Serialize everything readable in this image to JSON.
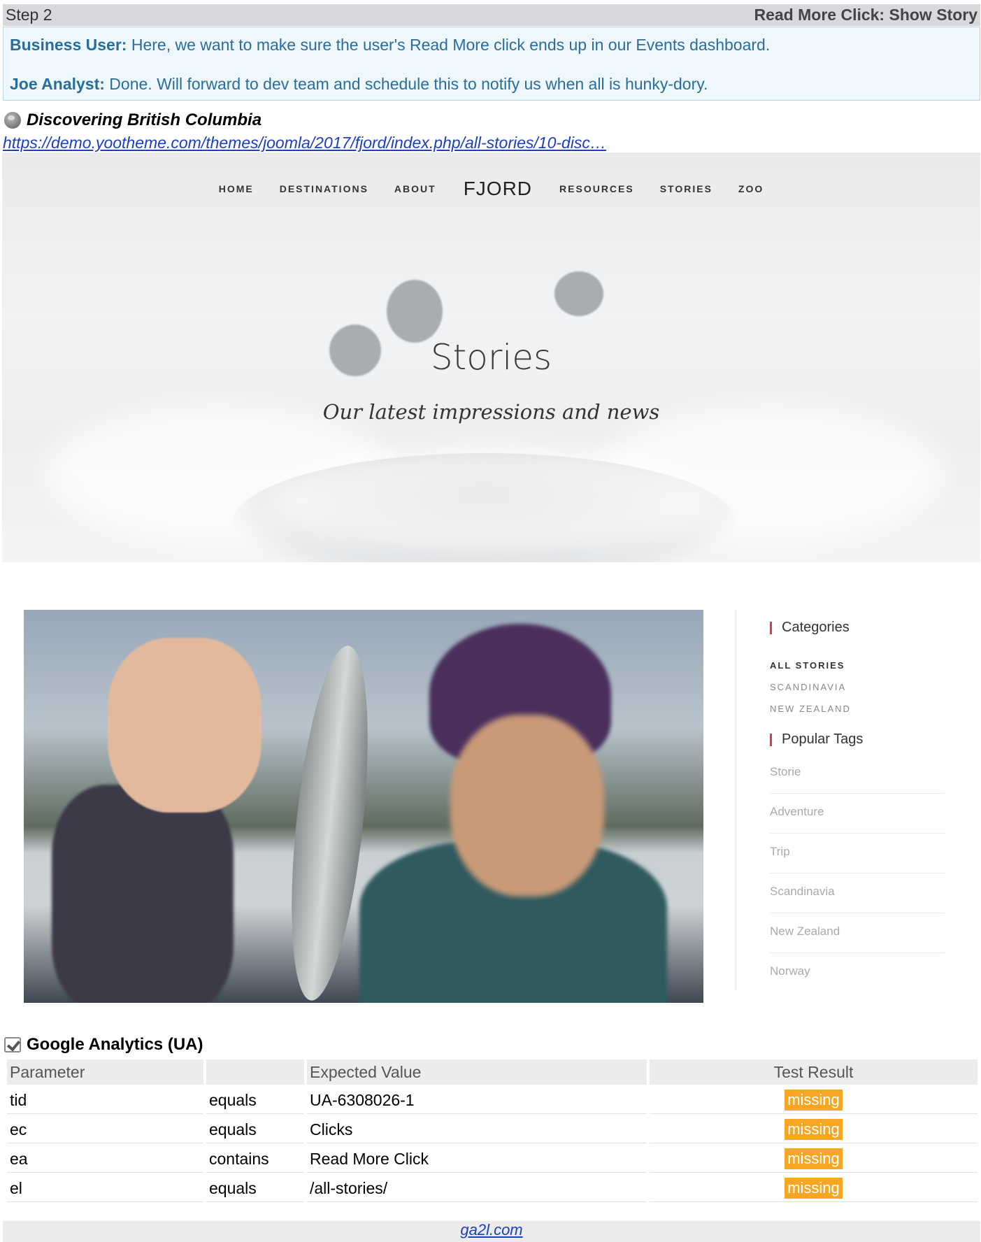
{
  "step": {
    "label": "Step 2",
    "title": "Read More Click: Show Story"
  },
  "dialog": {
    "business_user_label": "Business User:",
    "business_user_text": " Here, we want to make sure the user's Read More click ends up in our Events dashboard.",
    "analyst_label": "Joe Analyst:",
    "analyst_text": " Done. Will forward to dev team and schedule this to notify us when all is hunky-dory."
  },
  "page": {
    "title": "Discovering British Columbia",
    "url": "https://demo.yootheme.com/themes/joomla/2017/fjord/index.php/all-stories/10-disc…"
  },
  "site": {
    "nav_left": [
      "HOME",
      "DESTINATIONS",
      "ABOUT"
    ],
    "logo": "FJORD",
    "nav_right": [
      "RESOURCES",
      "STORIES",
      "ZOO"
    ],
    "hero_title": "Stories",
    "hero_subtitle": "Our latest impressions and news"
  },
  "sidebar": {
    "categories_heading": "Categories",
    "categories": [
      "ALL STORIES",
      "SCANDINAVIA",
      "NEW ZEALAND"
    ],
    "tags_heading": "Popular Tags",
    "tags": [
      "Storie",
      "Adventure",
      "Trip",
      "Scandinavia",
      "New Zealand",
      "Norway"
    ],
    "accent_color": "#e5334b"
  },
  "ga": {
    "title": "Google Analytics (UA)",
    "headers": [
      "Parameter",
      "",
      "Expected Value",
      "Test Result"
    ],
    "rows": [
      {
        "param": "tid",
        "op": "equals",
        "value": "UA-6308026-1",
        "result": "missing"
      },
      {
        "param": "ec",
        "op": "equals",
        "value": "Clicks",
        "result": "missing"
      },
      {
        "param": "ea",
        "op": "contains",
        "value": "Read More Click",
        "result": "missing"
      },
      {
        "param": "el",
        "op": "equals",
        "value": "/all-stories/",
        "result": "missing"
      }
    ],
    "missing_color": "#f5a623"
  },
  "footer": {
    "link": "ga2l.com"
  }
}
